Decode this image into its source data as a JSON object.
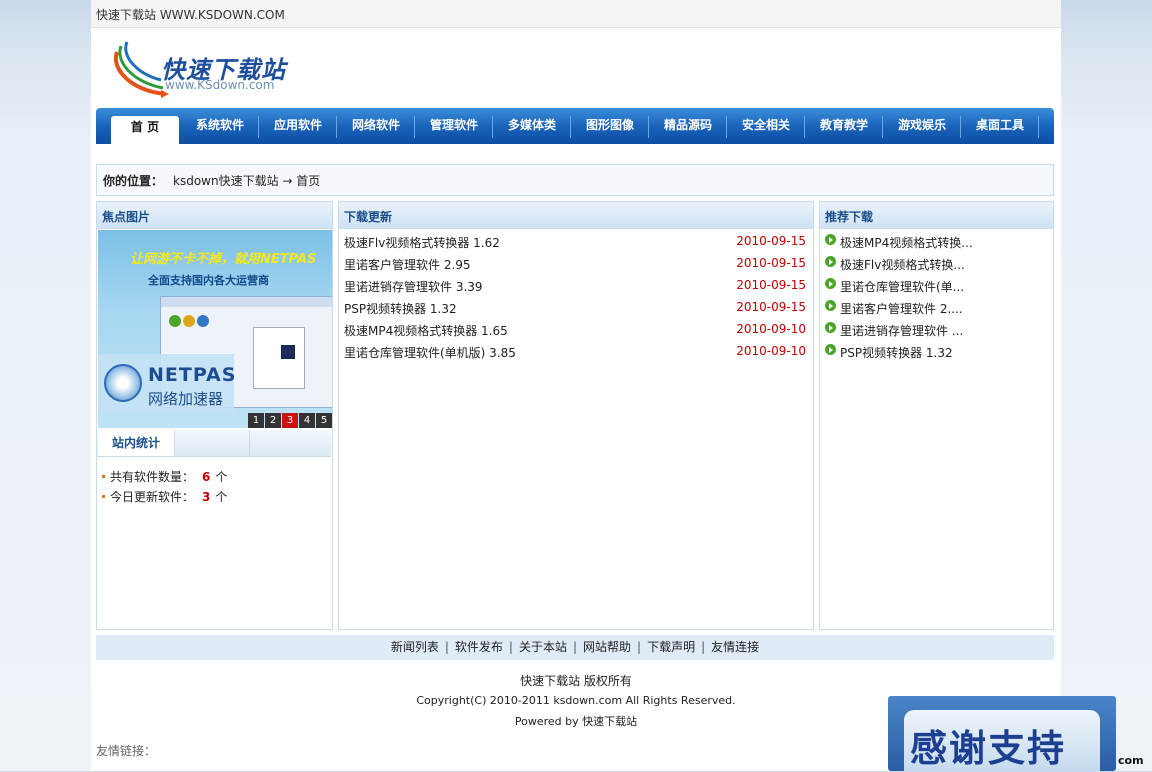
{
  "topbar": {
    "text": "快速下载站 WWW.KSDOWN.COM"
  },
  "logo": {
    "title": "快速下载站",
    "url": "www.KSdown.com"
  },
  "nav": {
    "items": [
      "首 页",
      "系统软件",
      "应用软件",
      "网络软件",
      "管理软件",
      "多媒体类",
      "图形图像",
      "精品源码",
      "安全相关",
      "教育教学",
      "游戏娱乐",
      "桌面工具"
    ]
  },
  "breadcrumb": {
    "label": "你的位置：",
    "path": "ksdown快速下载站 → 首页"
  },
  "focus": {
    "title": "焦点图片",
    "ad_slogan": "让网游不卡不掉，就用NETPAS",
    "ad_sub": "全面支持国内各大运营商",
    "ad_brand": "NETPAS",
    "ad_brand_sub": "网络加速器",
    "pages": [
      "1",
      "2",
      "3",
      "4",
      "5"
    ],
    "active_page": "3"
  },
  "stats": {
    "title": "站内统计",
    "rows": [
      {
        "label": "共有软件数量：",
        "value": "6",
        "unit": "个"
      },
      {
        "label": "今日更新软件：",
        "value": "3",
        "unit": "个"
      }
    ]
  },
  "downloads": {
    "title": "下载更新",
    "items": [
      {
        "name": "极速Flv视频格式转换器 1.62",
        "date": "2010-09-15"
      },
      {
        "name": "里诺客户管理软件 2.95",
        "date": "2010-09-15"
      },
      {
        "name": "里诺进销存管理软件 3.39",
        "date": "2010-09-15"
      },
      {
        "name": "PSP视频转换器 1.32",
        "date": "2010-09-15"
      },
      {
        "name": "极速MP4视频格式转换器 1.65",
        "date": "2010-09-10"
      },
      {
        "name": "里诺仓库管理软件(单机版) 3.85",
        "date": "2010-09-10"
      }
    ]
  },
  "recommended": {
    "title": "推荐下载",
    "items": [
      "极速MP4视频格式转换...",
      "极速Flv视频格式转换...",
      "里诺仓库管理软件(单...",
      "里诺客户管理软件 2....",
      "里诺进销存管理软件 ...",
      "PSP视频转换器 1.32"
    ]
  },
  "footer_links": [
    "新闻列表",
    "软件发布",
    "关于本站",
    "网站帮助",
    "下载声明",
    "友情连接"
  ],
  "footer": {
    "owner": "快速下载站 版权所有",
    "copyright": "Copyright(C) 2010-2011 ksdown.com All Rights Reserved.",
    "powered": "Powered by 快速下载站"
  },
  "friend_links": {
    "label": "友情链接："
  },
  "banner": {
    "text": "感谢支持",
    "suffix": "com"
  },
  "colors": {
    "nav_blue": "#1a63bb",
    "date_red": "#c00000",
    "panel_title": "#1a4f8c"
  }
}
